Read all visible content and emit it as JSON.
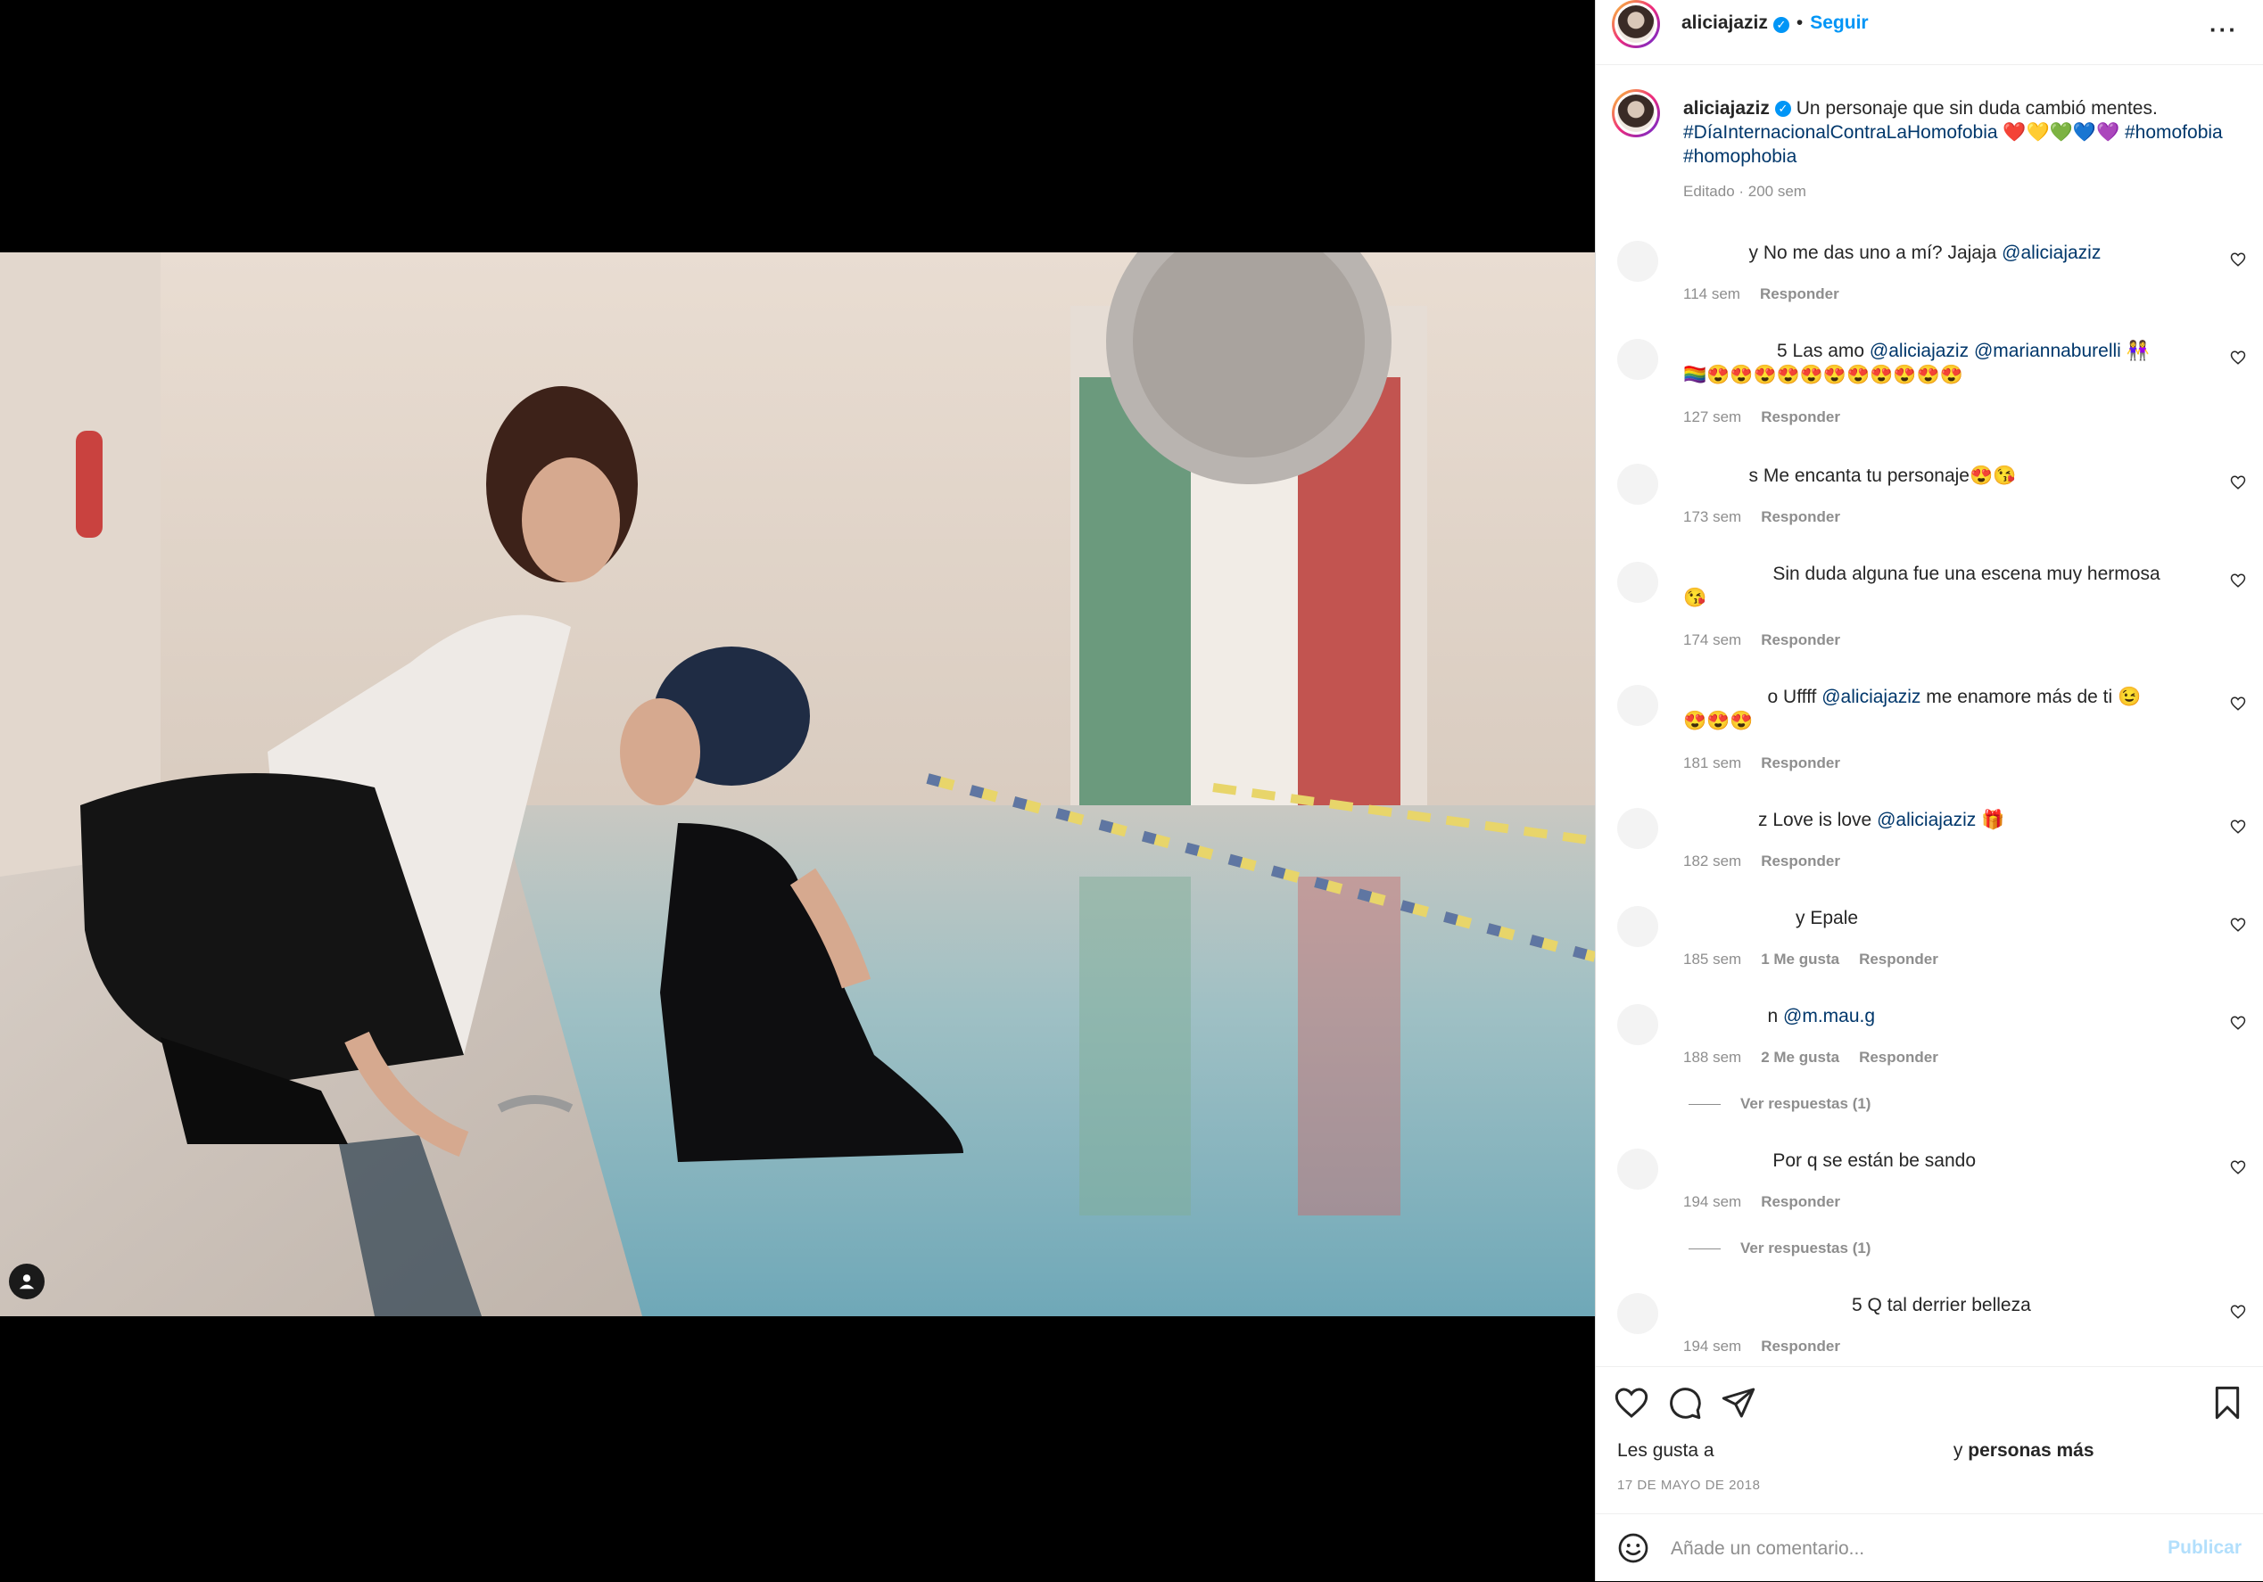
{
  "post": {
    "username": "aliciajaziz",
    "follow_label": "Seguir",
    "more_label": "···",
    "caption_text": " Un personaje que sin duda cambió mentes.",
    "hashtag1": "#DíaInternacionalContraLaHomofobia",
    "caption_emojis": " ❤️💛💚💙💜 ",
    "hashtag2": "#homofobia",
    "hashtag3": "#homophobia",
    "edited_meta": "Editado · 200 sem"
  },
  "comments": [
    {
      "user_partial": "y",
      "text": " No me das uno a mí? Jajaja ",
      "mention": "@aliciajaziz",
      "tail": "",
      "time": "114 sem",
      "likes": "",
      "reply": "Responder"
    },
    {
      "user_partial": "5",
      "text": " Las amo ",
      "mention": "@aliciajaziz",
      "mention2": "@mariannaburelli",
      "tail": " 👭",
      "line2": "🏳️‍🌈😍😍😍😍😍😍😍😍😍😍😍",
      "time": "127 sem",
      "likes": "",
      "reply": "Responder"
    },
    {
      "user_partial": "s",
      "text": " Me encanta tu personaje😍😘",
      "mention": "",
      "tail": "",
      "time": "173 sem",
      "likes": "",
      "reply": "Responder"
    },
    {
      "user_partial": "",
      "text": " Sin duda alguna fue una escena muy hermosa",
      "mention": "",
      "tail": "",
      "line2": "😘",
      "time": "174 sem",
      "likes": "",
      "reply": "Responder"
    },
    {
      "user_partial": "o",
      "text": " Uffff ",
      "mention": "@aliciajaziz",
      "tail": " me enamore más de ti 😉",
      "line2": "😍😍😍",
      "time": "181 sem",
      "likes": "",
      "reply": "Responder"
    },
    {
      "user_partial": "z",
      "text": " Love is love ",
      "mention": "@aliciajaziz",
      "tail": " 🎁",
      "time": "182 sem",
      "likes": "",
      "reply": "Responder"
    },
    {
      "user_partial": "y",
      "text": " Epale",
      "mention": "",
      "tail": "",
      "time": "185 sem",
      "likes": "1 Me gusta",
      "reply": "Responder"
    },
    {
      "user_partial": "n",
      "text": " ",
      "mention": "@m.mau.g",
      "tail": "",
      "time": "188 sem",
      "likes": "2 Me gusta",
      "reply": "Responder",
      "replies": "Ver respuestas (1)"
    },
    {
      "user_partial": "",
      "text": " Por q se están be sando",
      "mention": "",
      "tail": "",
      "time": "194 sem",
      "likes": "",
      "reply": "Responder",
      "replies": "Ver respuestas (1)"
    },
    {
      "user_partial": "5",
      "text": " Q tal derrier belleza",
      "mention": "",
      "tail": "",
      "time": "194 sem",
      "likes": "",
      "reply": "Responder"
    }
  ],
  "footer": {
    "likes_prefix": "Les gusta a",
    "likes_suffix_plain": " y ",
    "likes_suffix_bold": "personas más",
    "date": "17 DE MAYO DE 2018",
    "comment_placeholder": "Añade un comentario...",
    "publish_label": "Publicar"
  },
  "icons": {
    "like": "heart-icon",
    "comment": "comment-bubble-icon",
    "share": "paper-plane-icon",
    "save": "bookmark-icon",
    "emoji": "smiley-icon",
    "tag": "user-tag-icon",
    "verified": "verified-badge-icon"
  },
  "colors": {
    "link_blue": "#0095f6",
    "hashtag": "#00376b",
    "muted": "#8e8e8e",
    "publish_disabled": "#b2dffc"
  }
}
